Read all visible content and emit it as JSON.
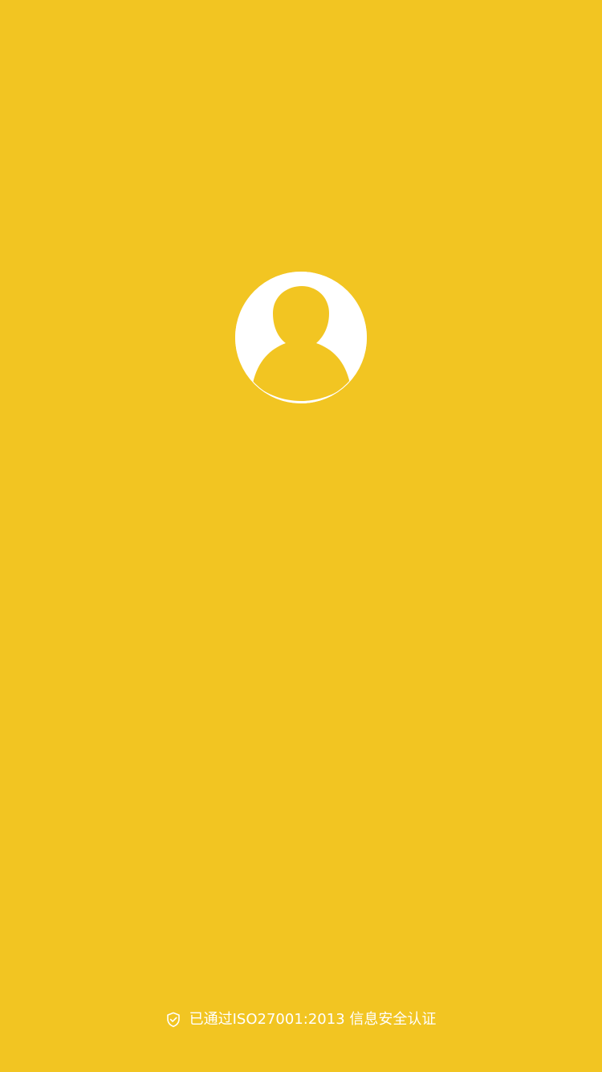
{
  "theme": {
    "background_color": "#F2C522",
    "foreground_color": "#FFFFFF"
  },
  "avatar": {
    "icon": "default-user-avatar-icon"
  },
  "footer": {
    "icon": "shield-check-icon",
    "certification_text": "已通过ISO27001:2013 信息安全认证"
  }
}
